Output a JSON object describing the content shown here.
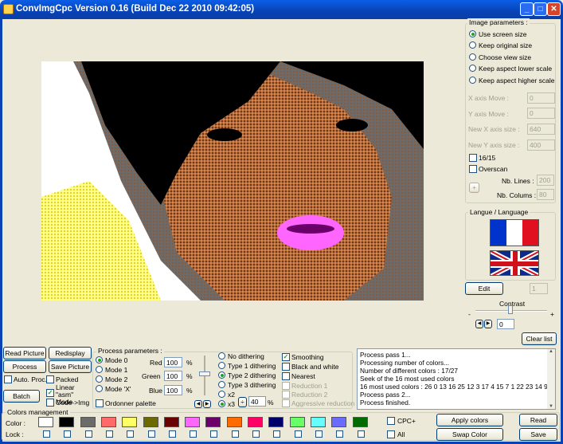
{
  "window": {
    "title": "ConvImgCpc Version 0.16 (Build Dec 22 2010 09:42:05)"
  },
  "image_params": {
    "title": "Image parameters :",
    "options": [
      "Use screen size",
      "Keep original size",
      "Choose view size",
      "Keep aspect lower scale",
      "Keep aspect higher scale"
    ],
    "x_move_label": "X axis Move :",
    "x_move": "0",
    "y_move_label": "Y axis Move :",
    "y_move": "0",
    "new_x_label": "New X axis size :",
    "new_x": "640",
    "new_y_label": "New Y axis size :",
    "new_y": "400",
    "ratio_label": "16/15",
    "overscan_label": "Overscan",
    "nb_lines_label": "Nb. Lines :",
    "nb_lines": "200",
    "nb_columns_label": "Nb. Colums :",
    "nb_columns": "80",
    "plus_label": "+"
  },
  "language": {
    "title": "Langue / Language"
  },
  "edit": {
    "button": "Edit",
    "value": "1"
  },
  "contrast": {
    "label": "Contrast",
    "minus": "-",
    "plus": "+",
    "value": "0"
  },
  "clear_list": "Clear list",
  "left_buttons": {
    "read_picture": "Read Picture",
    "redisplay": "Redisplay",
    "process": "Process",
    "save_picture": "Save Picture",
    "auto_proc": "Auto. Proc.",
    "batch": "Batch",
    "packed": "Packed",
    "linear_asm": "Linear \"asm\" Mode",
    "code_img": "Code->Img"
  },
  "process_params": {
    "title": "Process parameters :",
    "modes": [
      "Mode 0",
      "Mode 1",
      "Mode 2",
      "Mode 'X'"
    ],
    "red_label": "Red",
    "red": "100",
    "green_label": "Green",
    "green": "100",
    "blue_label": "Blue",
    "blue": "100",
    "pct": "%",
    "ordonner": "Ordonner palette",
    "dithering": [
      "No dithering",
      "Type 1 dithering",
      "Type 2 dithering",
      "Type 3 dithering"
    ],
    "x2": "x2",
    "x3": "x3",
    "scale_value": "40",
    "smoothing": "Smoothing",
    "black_white": "Black and white",
    "nearest": "Nearest",
    "reduction1": "Reduction 1",
    "reduction2": "Reduction 2",
    "aggressive": "Aggressive reduction"
  },
  "log": {
    "lines": [
      "Process pass 1...",
      "Processing number of colors...",
      "Number of different colors : 17/27",
      "Seek of the 16 most used colors",
      "16 most used colors : 26 0 13 16 25 12 3 17 4 15 7 1 22 23 14 9",
      "Process pass 2...",
      "Process finished."
    ]
  },
  "colors": {
    "title": "Colors management",
    "color_label": "Color :",
    "lock_label": "Lock :",
    "swatches": [
      "#ffffff",
      "#000000",
      "#6b6b6b",
      "#ff6b6b",
      "#ffff66",
      "#6b6b00",
      "#6b0000",
      "#ff66ff",
      "#6b006b",
      "#ff6b00",
      "#ff0066",
      "#00006b",
      "#66ff66",
      "#66ffff",
      "#6b6bff",
      "#006b00"
    ],
    "cpc_plus": "CPC+",
    "all": "All",
    "apply": "Apply colors",
    "swap": "Swap Color",
    "read": "Read",
    "save": "Save"
  }
}
